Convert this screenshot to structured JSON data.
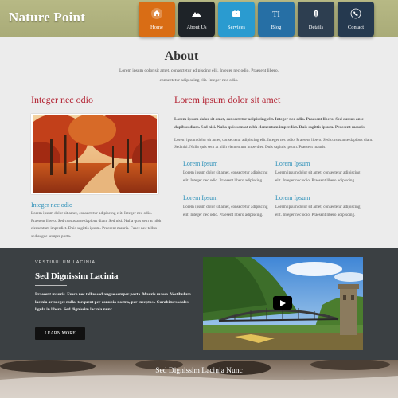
{
  "header": {
    "logo": "Nature Point",
    "nav": [
      {
        "label": "Home",
        "icon": "home-icon",
        "color": "#d96d15"
      },
      {
        "label": "About Us",
        "icon": "mountain-icon",
        "color": "#1e2328"
      },
      {
        "label": "Services",
        "icon": "briefcase-icon",
        "color": "#2a9bd0"
      },
      {
        "label": "Blog",
        "icon": "text-icon",
        "color": "#266fa5"
      },
      {
        "label": "Details",
        "icon": "leaf-icon",
        "color": "#2d3e50"
      },
      {
        "label": "Contact",
        "icon": "phone-icon",
        "color": "#25394f"
      }
    ]
  },
  "about": {
    "title": "About",
    "line1": "Lorem ipsum dolor sit amet, consectetur adipiscing elit. Integer nec odio. Praesent libero.",
    "line2": "consectetur adipiscing elit. Integer nec odio."
  },
  "left": {
    "heading": "Integer nec odio",
    "image_alt": "autumn-forest",
    "subheading": "Integer nec odio",
    "paragraph": "Lorem ipsum dolor sit amet, consectetur adipiscing elit. Integer nec odio. Praesent libero. Sed cursus ante dapibus diam. Sed nisi. Nulla quis sem at nibh elementum imperdiet. Duis sagittis ipsum. Praesent mauris. Fusce nec tellus sed augue semper porta."
  },
  "right": {
    "heading": "Lorem ipsum dolor sit amet",
    "bold_para": "Lorem ipsum dolor sit amet, consectetur adipiscing elit. Integer nec odio. Praesent libero. Sed cursus ante dapibus diam. Sed nisi. Nulla quis sem at nibh elementum imperdiet. Duis sagittis ipsum. Praesent mauris.",
    "para": "Lorem ipsum dolor sit amet, consectetur adipiscing elit. Integer nec odio. Praesent libero. Sed cursus ante dapibus diam. Sed nisi. Nulla quis sem at nibh elementum imperdiet. Duis sagittis ipsum. Praesent mauris.",
    "grid": [
      {
        "title": "Lorem Ipsum",
        "text": "Lorem ipsum dolor sit amet, consectetur adipiscing elit. Integer nec odio. Praesent libero adipiscing."
      },
      {
        "title": "Lorem Ipsum",
        "text": "Lorem ipsum dolor sit amet, consectetur adipiscing elit. Integer nec odio. Praesent libero adipiscing."
      },
      {
        "title": "Lorem Ipsum",
        "text": "Lorem ipsum dolor sit amet, consectetur adipiscing elit. Integer nec odio. Praesent libero adipiscing."
      },
      {
        "title": "Lorem Ipsum",
        "text": "Lorem ipsum dolor sit amet, consectetur adipiscing elit. Integer nec odio. Praesent libero adipiscing."
      }
    ]
  },
  "feature": {
    "kicker": "VESTIBULUM LACINIA",
    "title": "Sed Dignissim Lacinia",
    "paragraph": "Praesent mauris. Fusce nec tellus sed augue semper porta. Mauris massa. Vestibulum lacinia arcu eget nulla. torquent per conubia nostra, per inceptos . Curabitursodales ligula in libero. Sed dignissim lacinia nunc.",
    "button": "LEARN MORE",
    "video_alt": "stone-bridge-video"
  },
  "bottom": {
    "title": "Sed Dignissim Lacinia Nunc"
  },
  "colors": {
    "accent_red": "#b22030",
    "accent_blue": "#2a8fb8",
    "header_bg": "#b7b985",
    "dark_bg": "#3b4043"
  }
}
